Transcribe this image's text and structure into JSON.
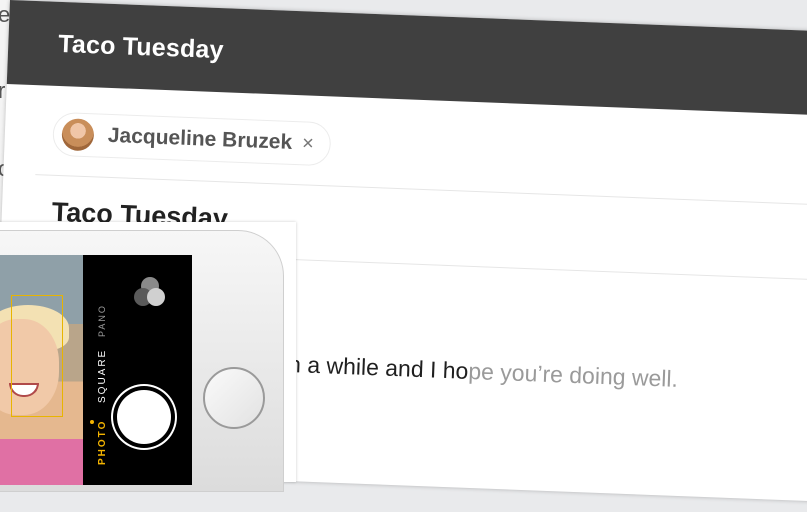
{
  "background": {
    "fragments": [
      "e",
      "r",
      "o"
    ]
  },
  "compose": {
    "window_title": "Taco Tuesday",
    "recipient": {
      "name": "Jacqueline Bruzek",
      "remove_symbol": "×"
    },
    "subject": "Taco Tuesday",
    "body": {
      "typed": "n a while and I ho",
      "suggestion": "pe you’re doing well."
    }
  },
  "camera": {
    "modes": [
      "PANO",
      "SQUARE",
      "PHOTO"
    ],
    "selected_mode": "PHOTO",
    "icons": [
      "filters-icon",
      "shutter-button",
      "home-button"
    ],
    "colors": {
      "accent": "#f3b300",
      "titlebar": "#404040"
    }
  }
}
